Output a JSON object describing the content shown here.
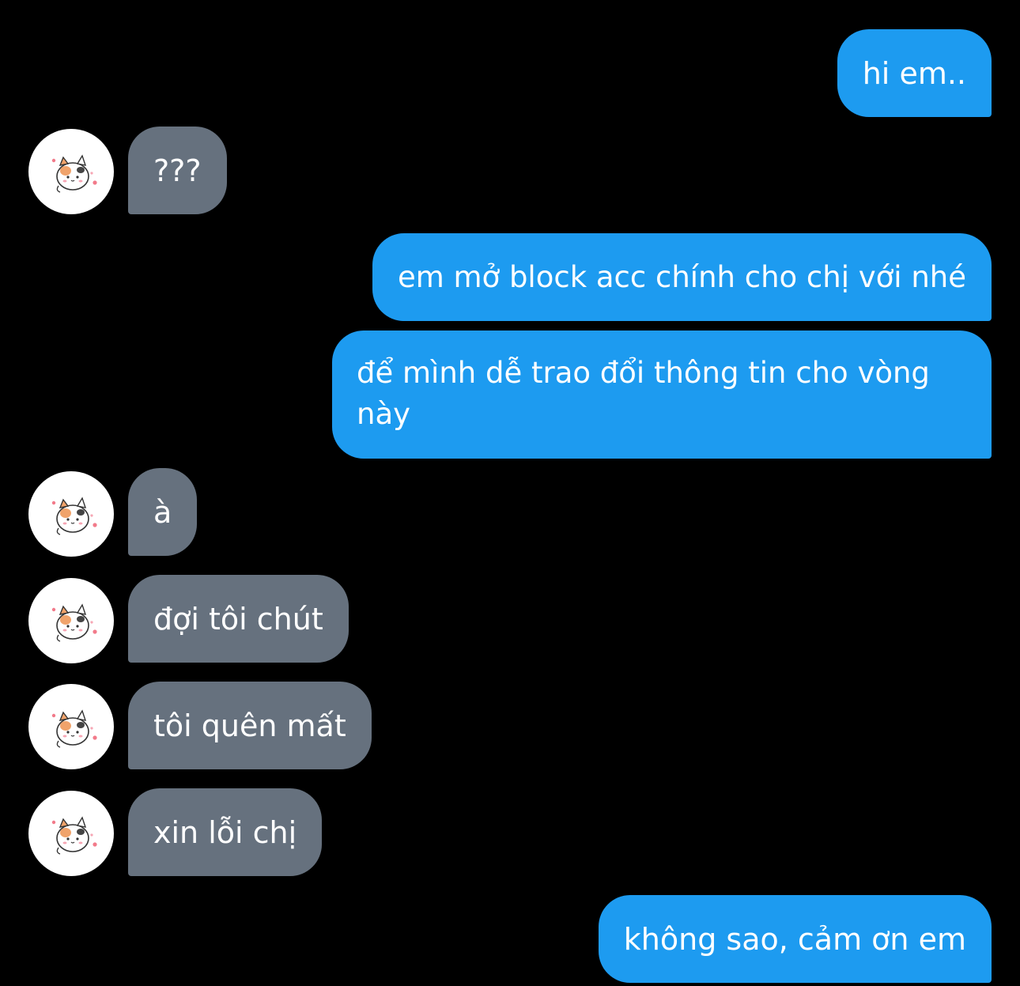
{
  "conversation": {
    "messages": [
      {
        "sender": "me",
        "text": "hi em.."
      },
      {
        "sender": "them",
        "text": "???"
      },
      {
        "sender": "me",
        "text": "em mở block acc chính cho chị với nhé"
      },
      {
        "sender": "me",
        "text": "để mình dễ trao đổi thông tin cho vòng này"
      },
      {
        "sender": "them",
        "text": "à"
      },
      {
        "sender": "them",
        "text": "đợi tôi chút"
      },
      {
        "sender": "them",
        "text": "tôi quên mất"
      },
      {
        "sender": "them",
        "text": "xin lỗi chị"
      },
      {
        "sender": "me",
        "text": "không sao, cảm ơn em"
      }
    ]
  },
  "colors": {
    "background": "#000000",
    "outgoing_bubble": "#1d9bf0",
    "incoming_bubble": "#66717e",
    "text": "#ffffff"
  },
  "avatar": {
    "icon": "cat-sticker-icon"
  }
}
